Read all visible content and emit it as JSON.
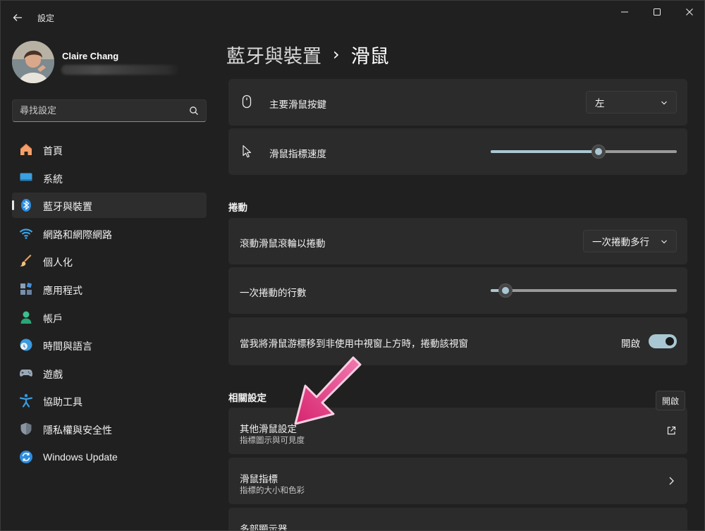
{
  "window": {
    "title": "設定"
  },
  "profile": {
    "name": "Claire Chang"
  },
  "search": {
    "placeholder": "尋找設定"
  },
  "sidebar": {
    "items": [
      {
        "label": "首頁",
        "icon": "home-icon"
      },
      {
        "label": "系統",
        "icon": "system-icon"
      },
      {
        "label": "藍牙與裝置",
        "icon": "bluetooth-icon"
      },
      {
        "label": "網路和網際網路",
        "icon": "wifi-icon"
      },
      {
        "label": "個人化",
        "icon": "paintbrush-icon"
      },
      {
        "label": "應用程式",
        "icon": "apps-icon"
      },
      {
        "label": "帳戶",
        "icon": "account-icon"
      },
      {
        "label": "時間與語言",
        "icon": "time-language-icon"
      },
      {
        "label": "遊戲",
        "icon": "gamepad-icon"
      },
      {
        "label": "協助工具",
        "icon": "accessibility-icon"
      },
      {
        "label": "隱私權與安全性",
        "icon": "shield-icon"
      },
      {
        "label": "Windows Update",
        "icon": "windows-update-icon"
      }
    ],
    "selected_index": 2
  },
  "breadcrumb": {
    "parent": "藍牙與裝置",
    "separator": "›",
    "current": "滑鼠"
  },
  "settings": {
    "primary_button": {
      "label": "主要滑鼠按鍵",
      "value": "左"
    },
    "pointer_speed": {
      "label": "滑鼠指標速度",
      "level_fraction": 0.58
    }
  },
  "scrolling": {
    "section_title": "捲動",
    "wheel_scroll": {
      "label": "滾動滑鼠滾輪以捲動",
      "value": "一次捲動多行"
    },
    "lines_to_scroll": {
      "label": "一次捲動的行數",
      "level_fraction": 0.08
    },
    "inactive_scroll": {
      "label": "當我將滑鼠游標移到非使用中視窗上方時，捲動該視窗",
      "state_label": "開啟",
      "on": true
    }
  },
  "related": {
    "section_title": "相關設定",
    "tooltip": "開啟",
    "items": [
      {
        "title": "其他滑鼠設定",
        "subtitle": "指標圖示與可見度",
        "icon": "external-link-icon"
      },
      {
        "title": "滑鼠指標",
        "subtitle": "指標的大小和色彩",
        "icon": "chevron-right-icon"
      },
      {
        "title": "多部顯示器",
        "subtitle": "",
        "icon": ""
      }
    ]
  },
  "colors": {
    "accent": "#a9c7d3",
    "annotation_arrow": "#e0357f"
  }
}
